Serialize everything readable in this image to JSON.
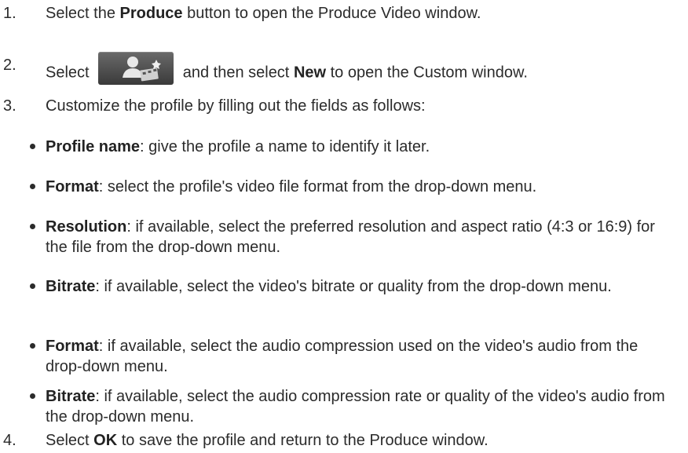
{
  "steps": [
    {
      "num": "1.",
      "pre": "Select the ",
      "bold": "Produce",
      "post": " button to open the Produce Video window."
    },
    {
      "num": "2.",
      "pre": "Select ",
      "icon": "produce-profile-icon",
      "mid": " and then select ",
      "bold": "New",
      "post": " to open the Custom window."
    },
    {
      "num": "3.",
      "text": "Customize the profile by filling out the fields as follows:"
    },
    {
      "num": "4.",
      "pre": "Select ",
      "bold": "OK",
      "post": " to save the profile and return to the Produce window."
    }
  ],
  "bullets": [
    {
      "label": "Profile name",
      "text": ": give the profile a name to identify it later."
    },
    {
      "label": "Format",
      "text": ": select the profile's video file format from the drop-down menu."
    },
    {
      "label": "Resolution",
      "text": ": if available, select the preferred resolution and aspect ratio (4:3 or 16:9) for the file from the drop-down menu."
    },
    {
      "label": "Bitrate",
      "text": ": if available, select the video's bitrate or quality from the drop-down menu."
    },
    {
      "label": "Format",
      "text": ": if available, select the audio compression used on the video's audio from the drop-down menu."
    },
    {
      "label": "Bitrate",
      "text": ": if available, select the audio compression rate or quality of the video's audio from the drop-down menu."
    }
  ]
}
